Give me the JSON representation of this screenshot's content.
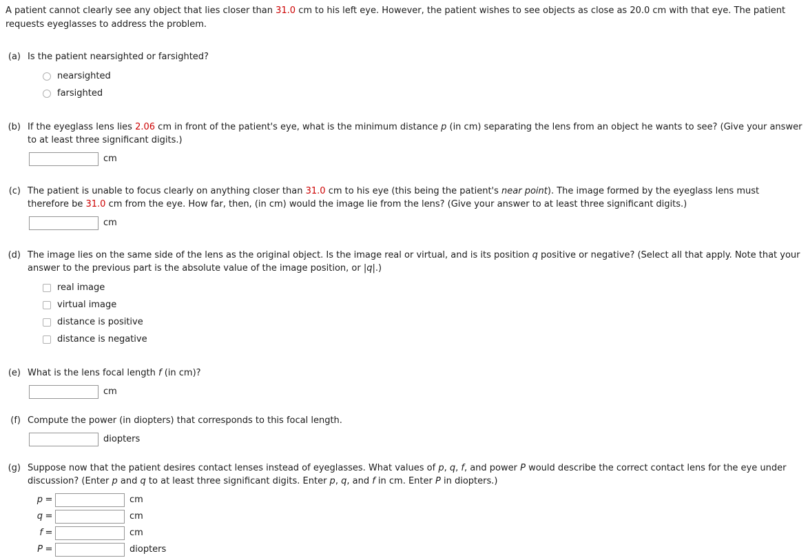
{
  "problem": {
    "intro_part1": "A patient cannot clearly see any object that lies closer than ",
    "intro_near_point": "31.0",
    "intro_part2": " cm to his left eye. However, the patient wishes to see objects as close as 20.0 cm with that eye. The patient requests eyeglasses to address the problem."
  },
  "parts": {
    "a": {
      "label": "(a)",
      "question": "Is the patient nearsighted or farsighted?",
      "options": [
        {
          "label": "nearsighted"
        },
        {
          "label": "farsighted"
        }
      ]
    },
    "b": {
      "label": "(b)",
      "text_1": "If the eyeglass lens lies ",
      "value_1": "2.06",
      "text_2": " cm in front of the patient's eye, what is the minimum distance ",
      "var_p": "p",
      "text_3": " (in cm) separating the lens from an object he wants to see? (Give your answer to at least three significant digits.)",
      "answer_value": "",
      "answer_unit": "cm"
    },
    "c": {
      "label": "(c)",
      "text_1": "The patient is unable to focus clearly on anything closer than ",
      "value_1": "31.0",
      "text_2": " cm to his eye (this being the patient's ",
      "emph_1": "near point",
      "text_3": "). The image formed by the eyeglass lens must therefore be ",
      "value_2": "31.0",
      "text_4": " cm from the eye. How far, then, (in cm) would the image lie from the lens? (Give your answer to at least three significant digits.)",
      "answer_value": "",
      "answer_unit": "cm"
    },
    "d": {
      "label": "(d)",
      "text_1": "The image lies on the same side of the lens as the original object. Is the image real or virtual, and is its position ",
      "var_q": "q",
      "text_2": " positive or negative? (Select all that apply. Note that your answer to the previous part is the absolute value of the image position, or |",
      "var_q2": "q",
      "text_3": "|.)",
      "options": [
        {
          "label": "real image"
        },
        {
          "label": "virtual image"
        },
        {
          "label": "distance is positive"
        },
        {
          "label": "distance is negative"
        }
      ]
    },
    "e": {
      "label": "(e)",
      "text_1": "What is the lens focal length ",
      "var_f": "f",
      "text_2": " (in cm)?",
      "answer_value": "",
      "answer_unit": "cm"
    },
    "f": {
      "label": "(f)",
      "question": "Compute the power (in diopters) that corresponds to this focal length.",
      "answer_value": "",
      "answer_unit": "diopters"
    },
    "g": {
      "label": "(g)",
      "text_1": "Suppose now that the patient desires contact lenses instead of eyeglasses. What values of ",
      "var_p": "p",
      "t_c1": ", ",
      "var_q": "q",
      "t_c2": ", ",
      "var_f": "f",
      "text_2": ", and power ",
      "var_P": "P",
      "text_3": " would describe the correct contact lens for the eye under discussion? (Enter ",
      "var_p2": "p",
      "text_4": " and ",
      "var_q2": "q",
      "text_5": " to at least three significant digits. Enter ",
      "var_p3": "p",
      "t_c3": ", ",
      "var_q3": "q",
      "text_6": ", and ",
      "var_f2": "f",
      "text_7": " in cm. Enter ",
      "var_P2": "P",
      "text_8": " in diopters.)",
      "fields": [
        {
          "name": "p",
          "eq": "=",
          "value": "",
          "unit": "cm"
        },
        {
          "name": "q",
          "eq": "=",
          "value": "",
          "unit": "cm"
        },
        {
          "name": "f",
          "eq": "=",
          "value": "",
          "unit": "cm"
        },
        {
          "name": "P",
          "eq": "=",
          "value": "",
          "unit": "diopters"
        }
      ]
    }
  },
  "colors": {
    "highlight_number": "#cc0000",
    "text": "#1a1a1a",
    "input_border": "#949494",
    "control_border": "#b0b0b0"
  }
}
